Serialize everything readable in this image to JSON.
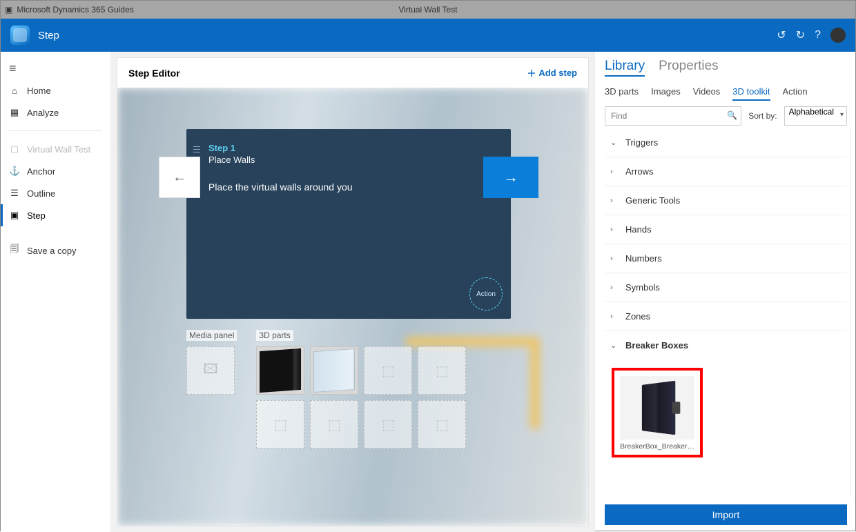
{
  "titlebar": {
    "app_name": "Microsoft Dynamics 365 Guides",
    "doc_name": "Virtual Wall Test"
  },
  "appbar": {
    "title": "Step"
  },
  "sidebar": {
    "items": [
      {
        "icon": "⌂",
        "label": "Home"
      },
      {
        "icon": "▦",
        "label": "Analyze"
      },
      {
        "icon": "▢",
        "label": "Virtual Wall Test",
        "disabled": true
      },
      {
        "icon": "⚓",
        "label": "Anchor"
      },
      {
        "icon": "☰",
        "label": "Outline"
      },
      {
        "icon": "▣",
        "label": "Step",
        "active": true
      },
      {
        "icon": "🗐",
        "label": "Save a copy"
      }
    ]
  },
  "editor": {
    "title": "Step Editor",
    "add_step": "Add step",
    "step_label": "Step 1",
    "step_title": "Place Walls",
    "step_body": "Place the virtual walls around you",
    "action_label": "Action",
    "media_panel_title": "Media panel",
    "parts_panel_title": "3D parts"
  },
  "library": {
    "tab_library": "Library",
    "tab_properties": "Properties",
    "subtabs": [
      "3D parts",
      "Images",
      "Videos",
      "3D toolkit",
      "Action"
    ],
    "subtab_active_index": 3,
    "find_placeholder": "Find",
    "sort_label": "Sort by:",
    "sort_value": "Alphabetical",
    "categories": [
      {
        "label": "Triggers",
        "expanded": true
      },
      {
        "label": "Arrows",
        "expanded": false
      },
      {
        "label": "Generic Tools",
        "expanded": false
      },
      {
        "label": "Hands",
        "expanded": false
      },
      {
        "label": "Numbers",
        "expanded": false
      },
      {
        "label": "Symbols",
        "expanded": false
      },
      {
        "label": "Zones",
        "expanded": false
      },
      {
        "label": "Breaker Boxes",
        "expanded": true,
        "bold": true
      }
    ],
    "highlighted_item_caption": "BreakerBox_Breaker_...",
    "import_label": "Import"
  }
}
